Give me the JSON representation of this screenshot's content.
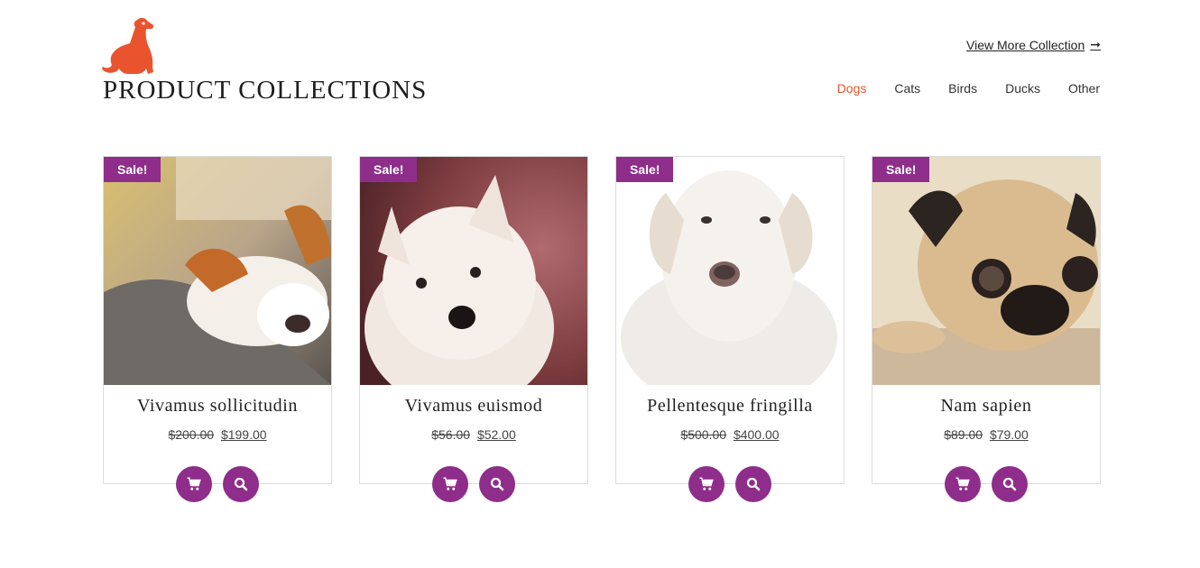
{
  "header": {
    "title": "PRODUCT COLLECTIONS",
    "view_more": "View More Collection",
    "logo_icon": "dog-icon"
  },
  "filters": [
    "Dogs",
    "Cats",
    "Birds",
    "Ducks",
    "Other"
  ],
  "active_filter": "Dogs",
  "colors": {
    "accent": "#8f2d8b",
    "brand": "#e9542e"
  },
  "products": [
    {
      "badge": "Sale!",
      "name": "Vivamus sollicitudin",
      "old_price": "$200.00",
      "price": "$199.00"
    },
    {
      "badge": "Sale!",
      "name": "Vivamus euismod",
      "old_price": "$56.00",
      "price": "$52.00"
    },
    {
      "badge": "Sale!",
      "name": "Pellentesque fringilla",
      "old_price": "$500.00",
      "price": "$400.00"
    },
    {
      "badge": "Sale!",
      "name": "Nam sapien",
      "old_price": "$89.00",
      "price": "$79.00"
    }
  ]
}
